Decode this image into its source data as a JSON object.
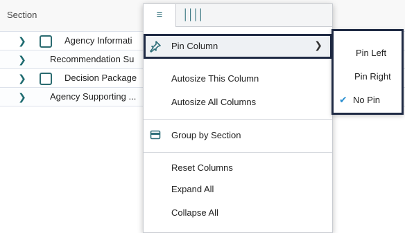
{
  "grid": {
    "header": {
      "column_label": "Section"
    },
    "rows": [
      {
        "text": "Agency Informati",
        "has_checkbox": true
      },
      {
        "text": "Recommendation Su",
        "has_checkbox": false
      },
      {
        "text": "Decision Package",
        "has_checkbox": true
      },
      {
        "text": "Agency Supporting ...",
        "has_checkbox": false
      }
    ]
  },
  "column_menu": {
    "tabs": [
      {
        "name": "general-tab",
        "icon": "hamburger-menu-icon",
        "glyph": "≡"
      },
      {
        "name": "columns-tab",
        "icon": "columns-icon",
        "glyph": "Ⅲ"
      }
    ],
    "items": {
      "pin_column": "Pin Column",
      "autosize_this": "Autosize This Column",
      "autosize_all": "Autosize All Columns",
      "group_by": "Group by Section",
      "reset_columns": "Reset Columns",
      "expand_all": "Expand All",
      "collapse_all": "Collapse All"
    },
    "icons": {
      "pin": "pin-icon",
      "group": "group-by-icon",
      "submenu_arrow": "chevron-right-icon"
    }
  },
  "pin_submenu": {
    "items": [
      {
        "label": "Pin Left",
        "checked": false
      },
      {
        "label": "Pin Right",
        "checked": false
      },
      {
        "label": "No Pin",
        "checked": true
      }
    ]
  },
  "colors": {
    "accent": "#2f6f7a",
    "highlight_border": "#1f2a44",
    "check": "#2a8fd0"
  }
}
